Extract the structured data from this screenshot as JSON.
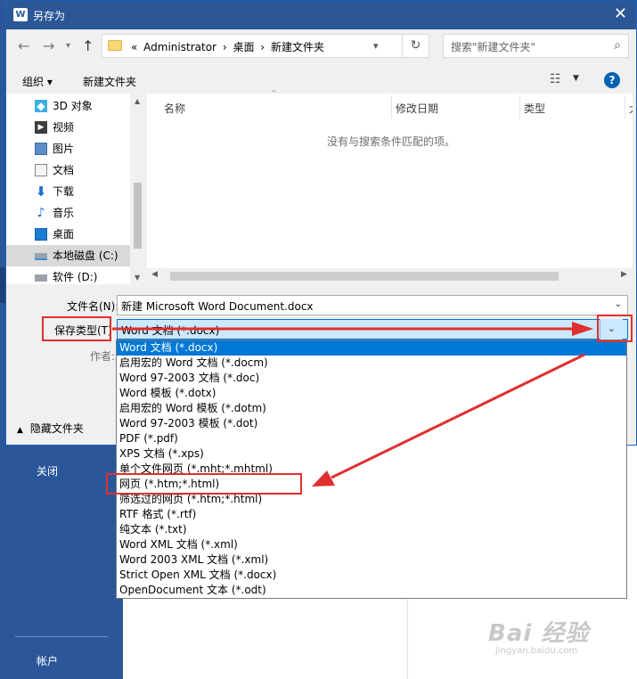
{
  "backstage": {
    "close_label": "关闭",
    "account_label": "帐户"
  },
  "watermark": {
    "brand": "Bai 经验",
    "url": "jingyan.baidu.com"
  },
  "dialog": {
    "title": "另存为",
    "app_badge": "W",
    "address": {
      "prefix": "«",
      "crumbs": [
        "Administrator",
        "桌面",
        "新建文件夹"
      ],
      "separator": "›"
    },
    "search_placeholder": "搜索\"新建文件夹\"",
    "toolbar": {
      "organize": "组织 ▾",
      "new_folder": "新建文件夹"
    },
    "nav_tree": [
      {
        "label": "3D 对象",
        "icon": "3d-objects-icon"
      },
      {
        "label": "视频",
        "icon": "video-icon"
      },
      {
        "label": "图片",
        "icon": "pictures-icon"
      },
      {
        "label": "文档",
        "icon": "documents-icon"
      },
      {
        "label": "下载",
        "icon": "download-icon"
      },
      {
        "label": "音乐",
        "icon": "music-icon"
      },
      {
        "label": "桌面",
        "icon": "desktop-icon"
      },
      {
        "label": "本地磁盘 (C:)",
        "icon": "drive-icon",
        "selected": true
      },
      {
        "label": "软件 (D:)",
        "icon": "drive-icon"
      }
    ],
    "columns": [
      "名称",
      "修改日期",
      "类型",
      "大"
    ],
    "empty_message": "没有与搜索条件匹配的项。",
    "filename_label": "文件名(N):",
    "filename_value": "新建 Microsoft Word Document.docx",
    "savetype_label": "保存类型(T)",
    "savetype_value": "Word 文档 (*.docx)",
    "author_label": "作者:",
    "hide_folders": "隐藏文件夹",
    "savetype_options": [
      {
        "label": "Word 文档 (*.docx)",
        "selected": true
      },
      {
        "label": "启用宏的 Word 文档 (*.docm)"
      },
      {
        "label": "Word 97-2003 文档 (*.doc)"
      },
      {
        "label": "Word 模板 (*.dotx)"
      },
      {
        "label": "启用宏的 Word 模板 (*.dotm)"
      },
      {
        "label": "Word 97-2003 模板 (*.dot)"
      },
      {
        "label": "PDF (*.pdf)"
      },
      {
        "label": "XPS 文档 (*.xps)"
      },
      {
        "label": "单个文件网页 (*.mht;*.mhtml)"
      },
      {
        "label": "网页 (*.htm;*.html)"
      },
      {
        "label": "筛选过的网页 (*.htm;*.html)"
      },
      {
        "label": "RTF 格式 (*.rtf)"
      },
      {
        "label": "纯文本 (*.txt)"
      },
      {
        "label": "Word XML 文档 (*.xml)"
      },
      {
        "label": "Word 2003 XML 文档 (*.xml)"
      },
      {
        "label": "Strict Open XML 文档 (*.docx)"
      },
      {
        "label": "OpenDocument 文本 (*.odt)"
      }
    ]
  },
  "colors": {
    "titlebar": "#2b5797",
    "backstage": "#2b579a",
    "selection": "#0078d7",
    "annotation": "#e02f2f"
  }
}
